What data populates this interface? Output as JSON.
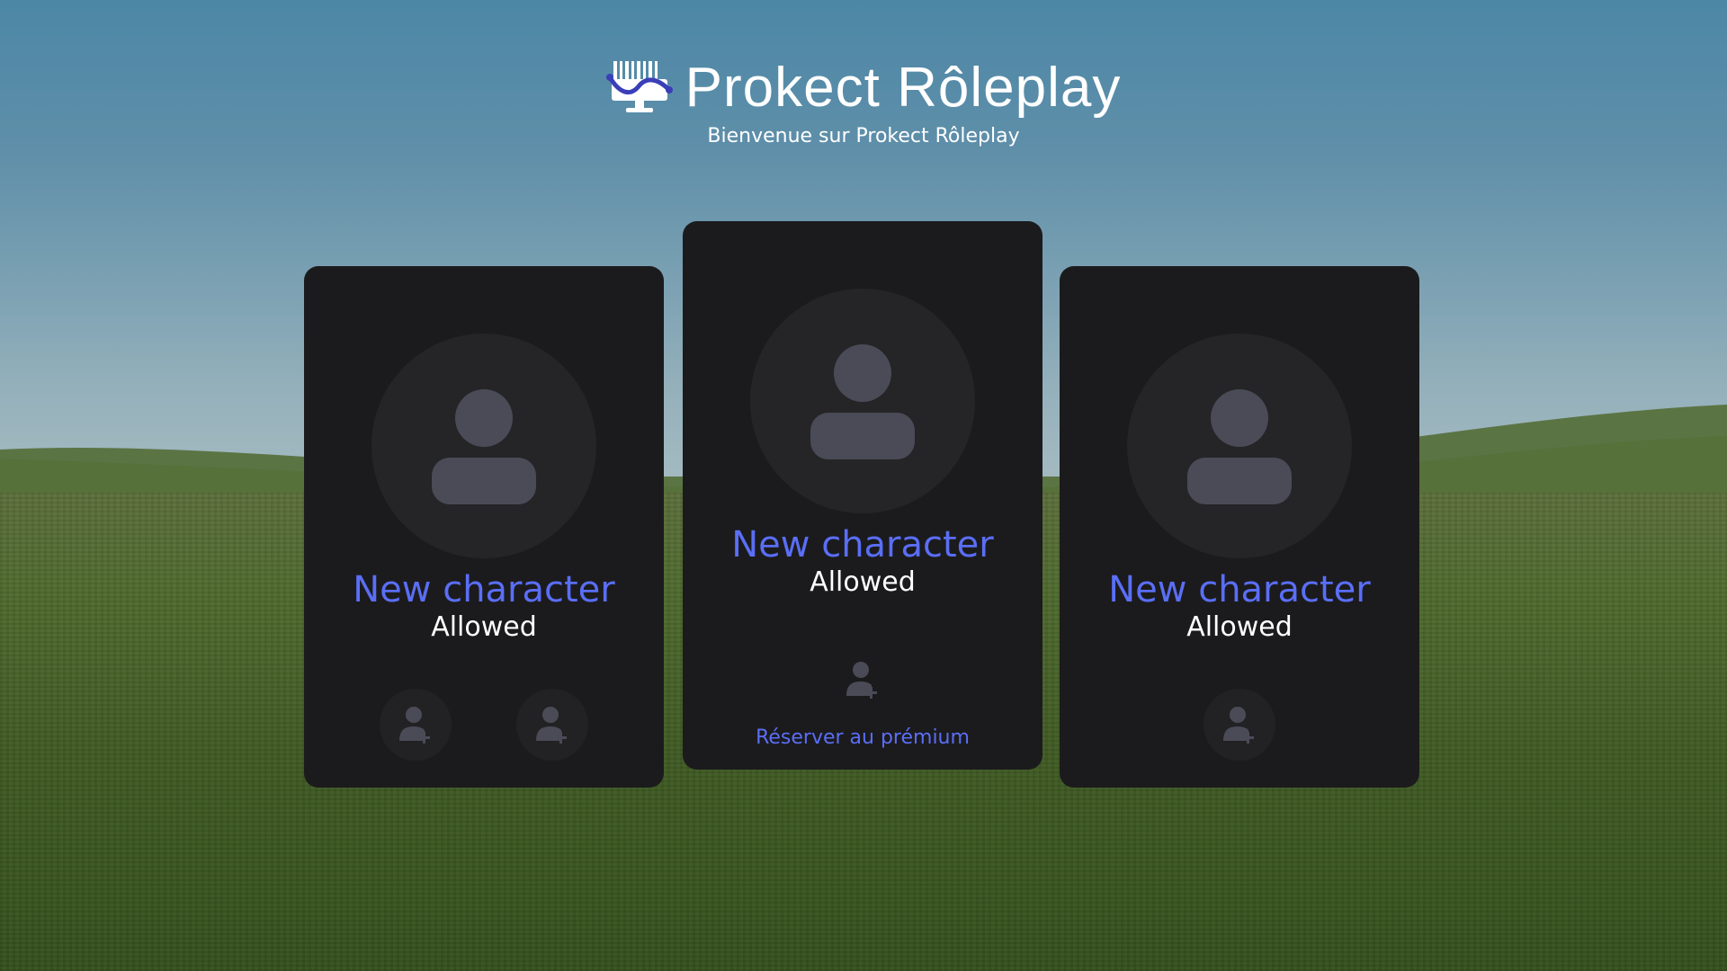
{
  "header": {
    "title": "Prokect Rôleplay",
    "subtitle": "Bienvenue sur Prokect Rôleplay"
  },
  "cards": [
    {
      "name": "New character",
      "status": "Allowed",
      "slots": 2
    },
    {
      "name": "New character",
      "status": "Allowed",
      "slots": 1,
      "premium_label": "Réserver au prémium"
    },
    {
      "name": "New character",
      "status": "Allowed",
      "slots": 1
    }
  ],
  "colors": {
    "accent": "#5a6ef6",
    "card_bg": "#1b1b1d",
    "avatar_bg": "#252527",
    "icon": "#4a4b57"
  },
  "icons": {
    "logo": "monitor-wave-logo-icon",
    "avatar": "user-silhouette-icon",
    "slot": "user-add-icon"
  }
}
